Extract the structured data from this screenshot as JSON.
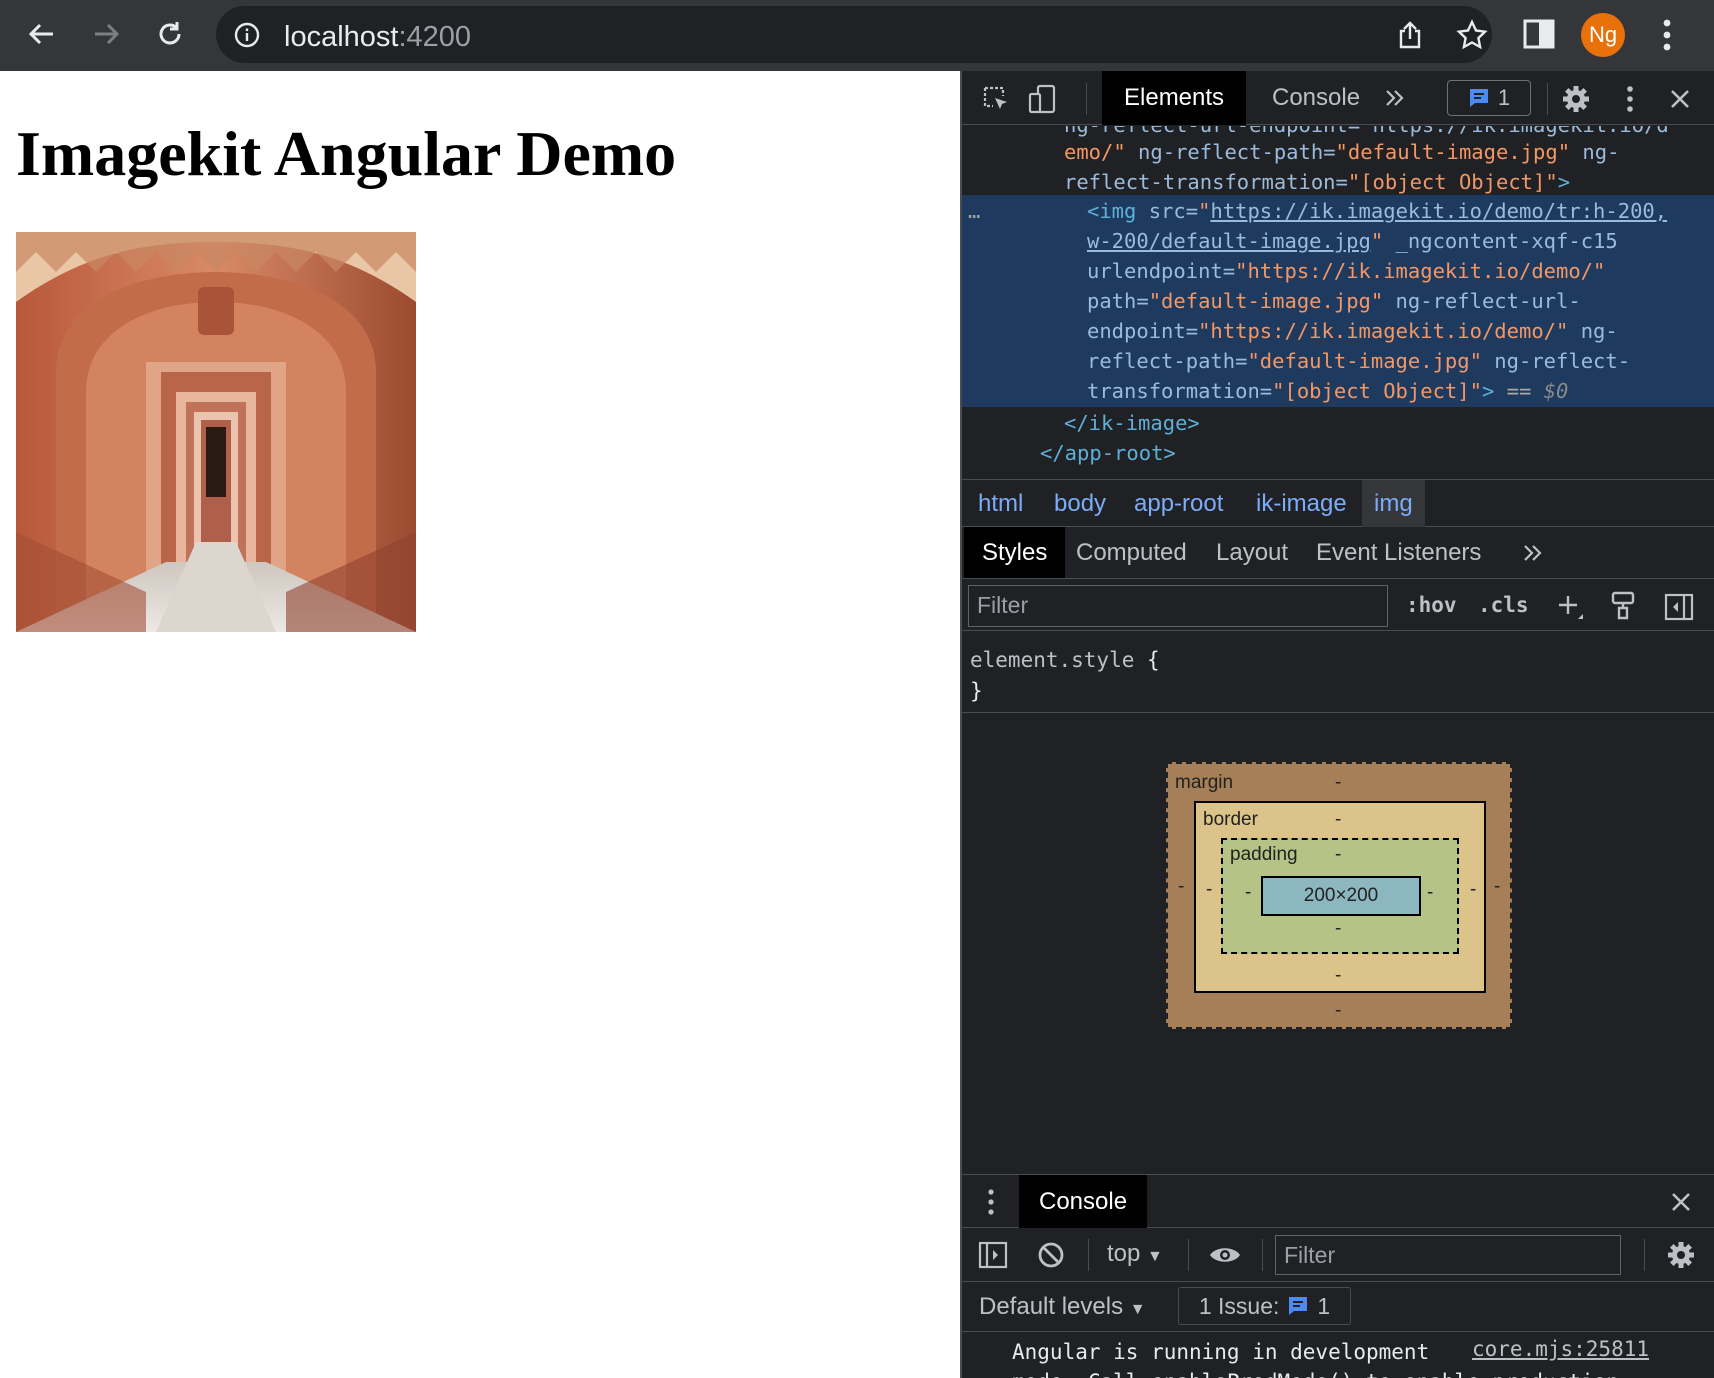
{
  "browser": {
    "url_host": "localhost",
    "url_port": ":4200",
    "avatar_initials": "Ng"
  },
  "page": {
    "heading": "Imagekit Angular Demo",
    "image_alt": "arched corridor photo"
  },
  "devtools": {
    "tabs": [
      "Elements",
      "Console"
    ],
    "issues_count": "1",
    "dom": {
      "line0": "ng-reflect-url-endpoint=\"https://ik.imagekit.io/d",
      "line1_a": "emo/\"",
      "line1_attr": " ng-reflect-path=",
      "line1_val": "\"default-image.jpg\"",
      "line1_attr2": " ng-",
      "line2_attr": "reflect-transformation=",
      "line2_val": "\"[object Object]\"",
      "line2_end": ">",
      "sel_dots": "…",
      "sel1_tag": "<img",
      "sel1_attr": " src=",
      "sel1_q": "\"",
      "sel1_link": "https://ik.imagekit.io/demo/tr:h-200,",
      "sel2_link": "w-200/default-image.jpg",
      "sel2_q": "\"",
      "sel2_attr": " _ngcontent-xqf-c15",
      "sel3_attr": "urlendpoint=",
      "sel3_val": "\"https://ik.imagekit.io/demo/\"",
      "sel4_attr": "path=",
      "sel4_val": "\"default-image.jpg\"",
      "sel4_attr2": " ng-reflect-url-",
      "sel5_attr": "endpoint=",
      "sel5_val": "\"https://ik.imagekit.io/demo/\"",
      "sel5_attr2": " ng-",
      "sel6_attr": "reflect-path=",
      "sel6_val": "\"default-image.jpg\"",
      "sel6_attr2": " ng-reflect-",
      "sel7_attr": "transformation=",
      "sel7_val": "\"[object Object]\"",
      "sel7_end": ">",
      "sel7_eq": " == ",
      "sel7_dollar": "$0",
      "close_ik": "</ik-image>",
      "close_root": "</app-root>"
    },
    "breadcrumbs": [
      "html",
      "body",
      "app-root",
      "ik-image",
      "img"
    ],
    "sub_tabs": [
      "Styles",
      "Computed",
      "Layout",
      "Event Listeners"
    ],
    "filter_placeholder": "Filter",
    "hov": ":hov",
    "cls": ".cls",
    "element_style_selector": "element.style",
    "element_style_open": " {",
    "element_style_close": "}",
    "box_model": {
      "margin_label": "margin",
      "border_label": "border",
      "padding_label": "padding",
      "content_size": "200×200",
      "dash": "-"
    },
    "console": {
      "tab_label": "Console",
      "context": "top",
      "filter_placeholder": "Filter",
      "levels": "Default levels",
      "issues_text": "1 Issue:",
      "issues_count": "1",
      "message": "Angular is running in development",
      "message_line2": "mode. Call enableProdMode() to enable production",
      "source": "core.mjs:25811"
    }
  },
  "colors": {
    "accent_blue": "#7cacf8",
    "avatar": "#e8710a",
    "selected_row": "#1f3a5f"
  }
}
